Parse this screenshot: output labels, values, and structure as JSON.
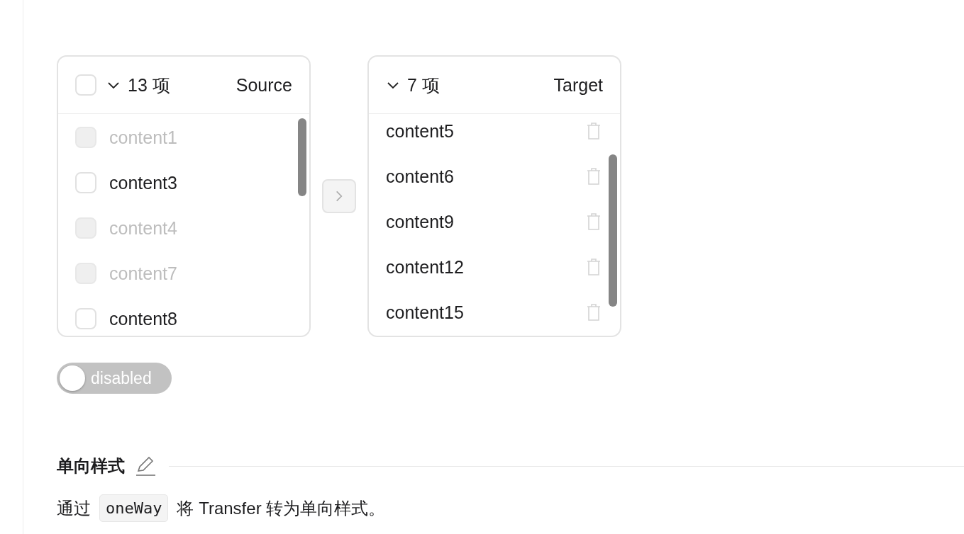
{
  "transfer": {
    "source": {
      "header_checked": false,
      "count": "13 项",
      "title": "Source",
      "items": [
        {
          "label": "content1",
          "checked": false,
          "disabled": true
        },
        {
          "label": "content3",
          "checked": false,
          "disabled": false
        },
        {
          "label": "content4",
          "checked": false,
          "disabled": true
        },
        {
          "label": "content7",
          "checked": false,
          "disabled": true
        },
        {
          "label": "content8",
          "checked": false,
          "disabled": false
        }
      ]
    },
    "move_button": {
      "disabled": true
    },
    "target": {
      "count": "7 项",
      "title": "Target",
      "items": [
        {
          "label": "content5"
        },
        {
          "label": "content6"
        },
        {
          "label": "content9"
        },
        {
          "label": "content12"
        },
        {
          "label": "content15"
        }
      ]
    }
  },
  "switch": {
    "label": "disabled",
    "on": false
  },
  "section": {
    "title": "单向样式",
    "description": {
      "before": "通过",
      "code": "oneWay",
      "after": "将 Transfer 转为单向样式。"
    }
  }
}
